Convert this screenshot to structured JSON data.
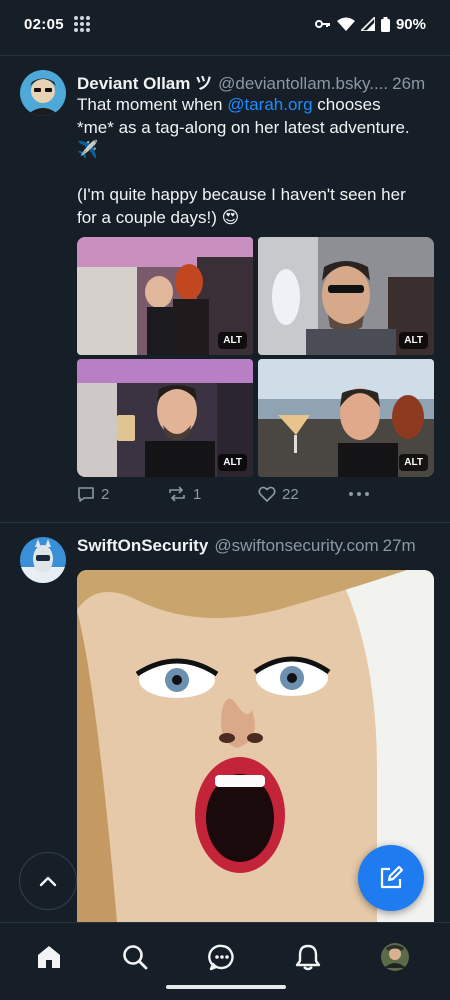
{
  "status_bar": {
    "time": "02:05",
    "battery": "90%"
  },
  "posts": [
    {
      "display_name": "Deviant Ollam ツ",
      "handle": "@deviantollam.bsky....",
      "time": "26m",
      "text_line1_pre": "That moment when ",
      "mention": "@tarah.org",
      "text_line1_post": " chooses",
      "text_line2": "*me* as a tag-along on her latest adventure.",
      "text_line3": "✈️",
      "text_line4": "(I'm quite happy because I haven't seen her",
      "text_line5": "for a couple days!) 😍",
      "images": [
        {
          "alt_badge": "ALT"
        },
        {
          "alt_badge": "ALT"
        },
        {
          "alt_badge": "ALT"
        },
        {
          "alt_badge": "ALT"
        }
      ],
      "replies": "2",
      "reposts": "1",
      "likes": "22"
    },
    {
      "display_name": "SwiftOnSecurity",
      "handle": "@swiftonsecurity.com",
      "time": "27m"
    }
  ],
  "icons": {
    "reply": "speech-bubble-icon",
    "repost": "repost-arrows-icon",
    "like": "heart-icon",
    "more": "ellipsis-icon",
    "scroll_top": "chevron-up-icon",
    "compose": "compose-pencil-icon",
    "nav": [
      "home-icon",
      "search-icon",
      "chat-icon",
      "bell-icon",
      "profile-avatar"
    ]
  },
  "colors": {
    "background": "#161e27",
    "accent": "#208bfe",
    "compose_button": "#1f7cf0",
    "muted_text": "#8b98a5"
  }
}
